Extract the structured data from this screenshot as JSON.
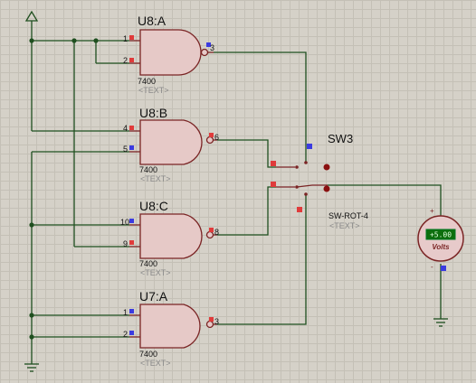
{
  "gates": [
    {
      "ref": "U8:A",
      "type": "7400",
      "text": "<TEXT>",
      "pin_in1": "1",
      "pin_in2": "2",
      "pin_out": "3"
    },
    {
      "ref": "U8:B",
      "type": "7400",
      "text": "<TEXT>",
      "pin_in1": "4",
      "pin_in2": "5",
      "pin_out": "6"
    },
    {
      "ref": "U8:C",
      "type": "7400",
      "text": "<TEXT>",
      "pin_in1": "10",
      "pin_in2": "9",
      "pin_out": "8"
    },
    {
      "ref": "U7:A",
      "type": "7400",
      "text": "<TEXT>",
      "pin_in1": "1",
      "pin_in2": "2",
      "pin_out": "3"
    }
  ],
  "switch": {
    "ref": "SW3",
    "type": "SW-ROT-4",
    "text": "<TEXT>"
  },
  "voltmeter": {
    "reading": "+5.00",
    "unit": "Volts",
    "plus": "+",
    "minus": "-"
  },
  "colors": {
    "logic_high": "#e03b3b",
    "logic_low": "#3b3be0",
    "wire": "#1f4f1f",
    "component": "#7a2424"
  }
}
